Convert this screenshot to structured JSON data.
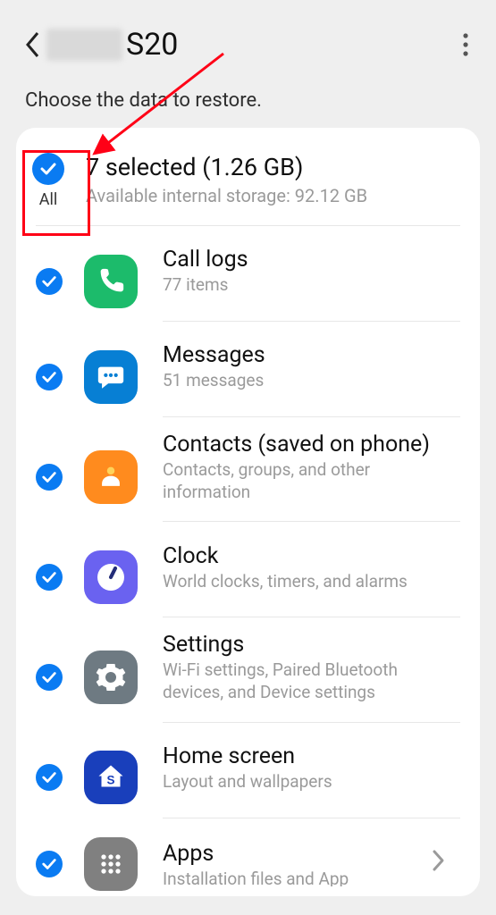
{
  "header": {
    "device_title": "S20"
  },
  "subtitle": "Choose the data to restore.",
  "summary": {
    "title": "7 selected (1.26 GB)",
    "subtitle": "Available internal storage: 92.12 GB",
    "all_label": "All"
  },
  "items": [
    {
      "title": "Call logs",
      "sub": "77 items"
    },
    {
      "title": "Messages",
      "sub": "51 messages"
    },
    {
      "title": "Contacts (saved on phone)",
      "sub": "Contacts, groups, and other information"
    },
    {
      "title": "Clock",
      "sub": "World clocks, timers, and alarms"
    },
    {
      "title": "Settings",
      "sub": "Wi-Fi settings, Paired Bluetooth devices, and Device settings"
    },
    {
      "title": "Home screen",
      "sub": "Layout and wallpapers"
    },
    {
      "title": "Apps",
      "sub": "Installation files and App"
    }
  ]
}
